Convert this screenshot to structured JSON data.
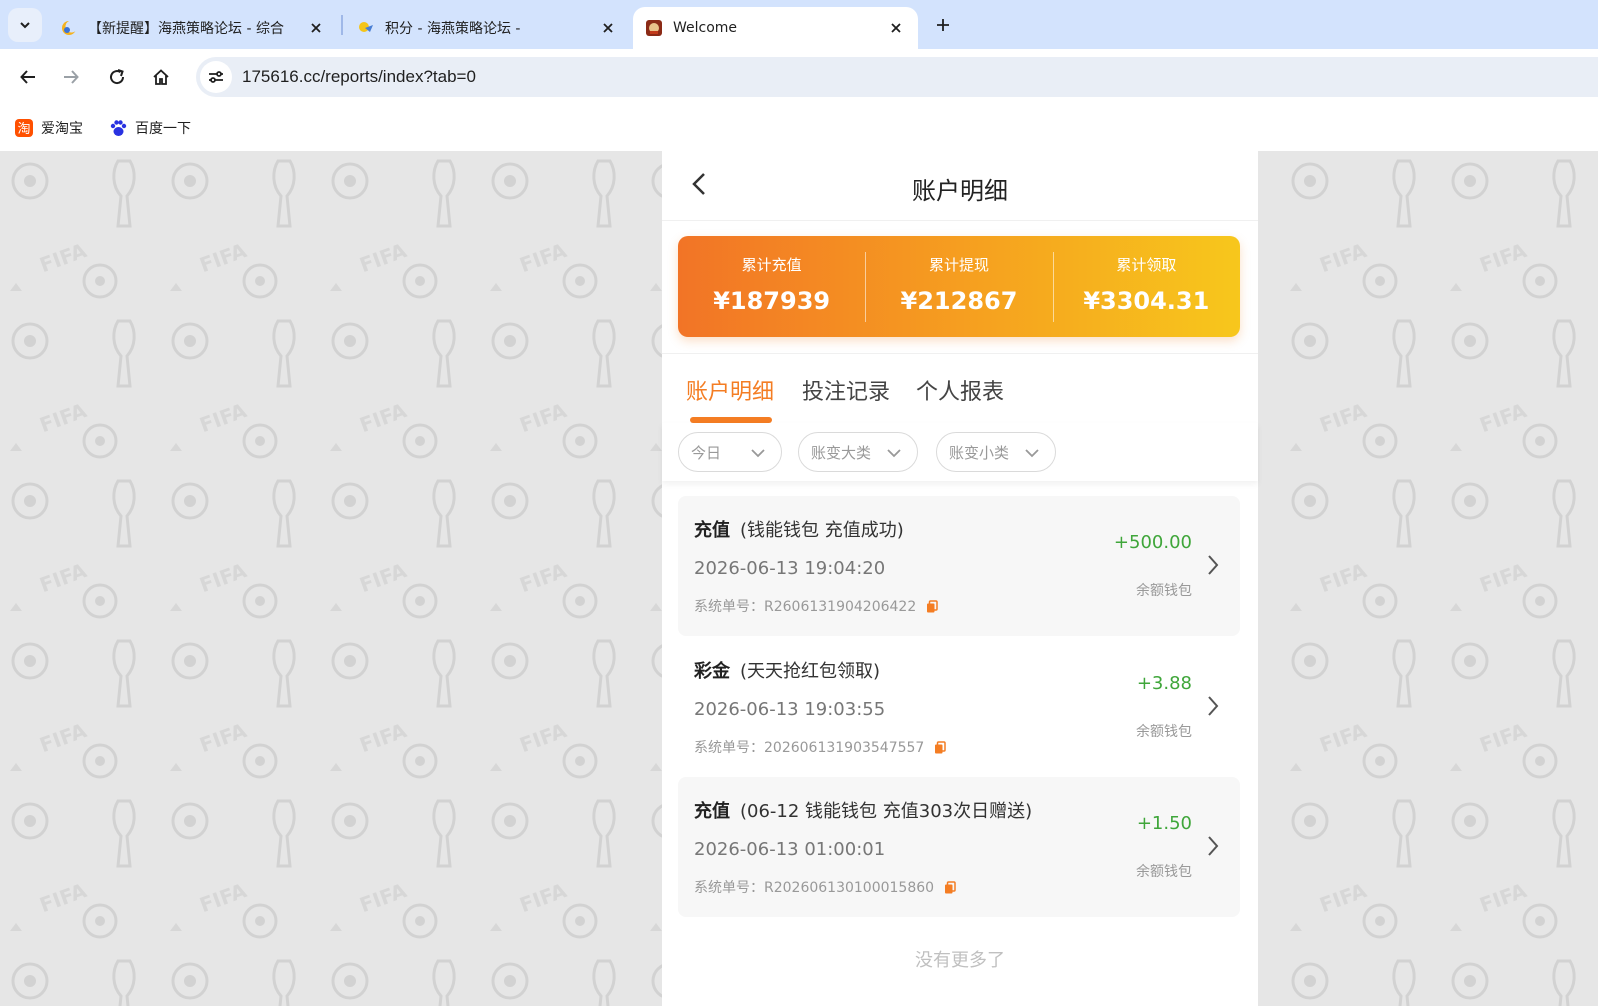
{
  "browser": {
    "tabs": [
      {
        "title": "【新提醒】海燕策略论坛 - 综合"
      },
      {
        "title": "积分 - 海燕策略论坛 -"
      },
      {
        "title": "Welcome"
      }
    ],
    "url": "175616.cc/reports/index?tab=0",
    "bookmarks": [
      {
        "label": "爱淘宝",
        "icon": "taobao-icon"
      },
      {
        "label": "百度一下",
        "icon": "baidu-paw-icon"
      }
    ]
  },
  "page": {
    "title": "账户明细",
    "summary": [
      {
        "label": "累计充值",
        "value": "¥187939"
      },
      {
        "label": "累计提现",
        "value": "¥212867"
      },
      {
        "label": "累计领取",
        "value": "¥3304.31"
      }
    ],
    "tabs": [
      {
        "label": "账户明细",
        "active": true
      },
      {
        "label": "投注记录",
        "active": false
      },
      {
        "label": "个人报表",
        "active": false
      }
    ],
    "filters": [
      {
        "label": "今日"
      },
      {
        "label": "账变大类"
      },
      {
        "label": "账变小类"
      }
    ],
    "records": [
      {
        "type": "充值",
        "desc": "(钱能钱包 充值成功)",
        "time": "2026-06-13 19:04:20",
        "order_no": "系统单号：R2606131904206422",
        "amount": "+500.00",
        "wallet": "余额钱包"
      },
      {
        "type": "彩金",
        "desc": "(天天抢红包领取)",
        "time": "2026-06-13 19:03:55",
        "order_no": "系统单号：202606131903547557",
        "amount": "+3.88",
        "wallet": "余额钱包"
      },
      {
        "type": "充值",
        "desc": "(06-12 钱能钱包 充值303次日赠送)",
        "time": "2026-06-13 01:00:01",
        "order_no": "系统单号：R202606130100015860",
        "amount": "+1.50",
        "wallet": "余额钱包"
      }
    ],
    "no_more": "没有更多了"
  },
  "colors": {
    "accent": "#f47d23",
    "positive": "#3fa63a",
    "tabstrip": "#d3e3fd"
  }
}
